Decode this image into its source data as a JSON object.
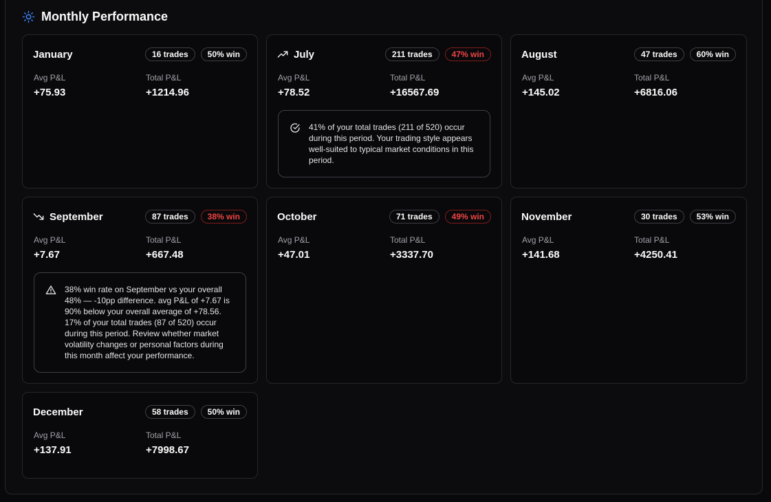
{
  "header": {
    "title": "Monthly Performance",
    "icon": "sun-icon",
    "accent": "#3b82f6"
  },
  "labels": {
    "avg": "Avg P&L",
    "total": "Total P&L"
  },
  "colors": {
    "negative": "#ef4444",
    "background": "#09090b",
    "border": "#27272a"
  },
  "months": [
    {
      "name": "January",
      "trades": "16 trades",
      "win": "50% win",
      "win_status": "neutral",
      "avg": "+75.93",
      "total": "+1214.96"
    },
    {
      "name": "July",
      "icon": "trending-up-icon",
      "trades": "211 trades",
      "win": "47% win",
      "win_status": "bad",
      "avg": "+78.52",
      "total": "+16567.69",
      "note": {
        "icon": "check-circle-icon",
        "text": "41% of your total trades (211 of 520) occur during this period. Your trading style appears well-suited to typical market conditions in this period."
      }
    },
    {
      "name": "August",
      "trades": "47 trades",
      "win": "60% win",
      "win_status": "neutral",
      "avg": "+145.02",
      "total": "+6816.06"
    },
    {
      "name": "September",
      "icon": "trending-down-icon",
      "trades": "87 trades",
      "win": "38% win",
      "win_status": "bad",
      "avg": "+7.67",
      "total": "+667.48",
      "note": {
        "icon": "warning-icon",
        "text": "38% win rate on September vs your overall 48% — -10pp difference. avg P&L of +7.67 is 90% below your overall average of +78.56. 17% of your total trades (87 of 520) occur during this period. Review whether market volatility changes or personal factors during this month affect your performance."
      }
    },
    {
      "name": "October",
      "trades": "71 trades",
      "win": "49% win",
      "win_status": "bad",
      "avg": "+47.01",
      "total": "+3337.70"
    },
    {
      "name": "November",
      "trades": "30 trades",
      "win": "53% win",
      "win_status": "neutral",
      "avg": "+141.68",
      "total": "+4250.41"
    },
    {
      "name": "December",
      "trades": "58 trades",
      "win": "50% win",
      "win_status": "neutral",
      "avg": "+137.91",
      "total": "+7998.67"
    }
  ]
}
